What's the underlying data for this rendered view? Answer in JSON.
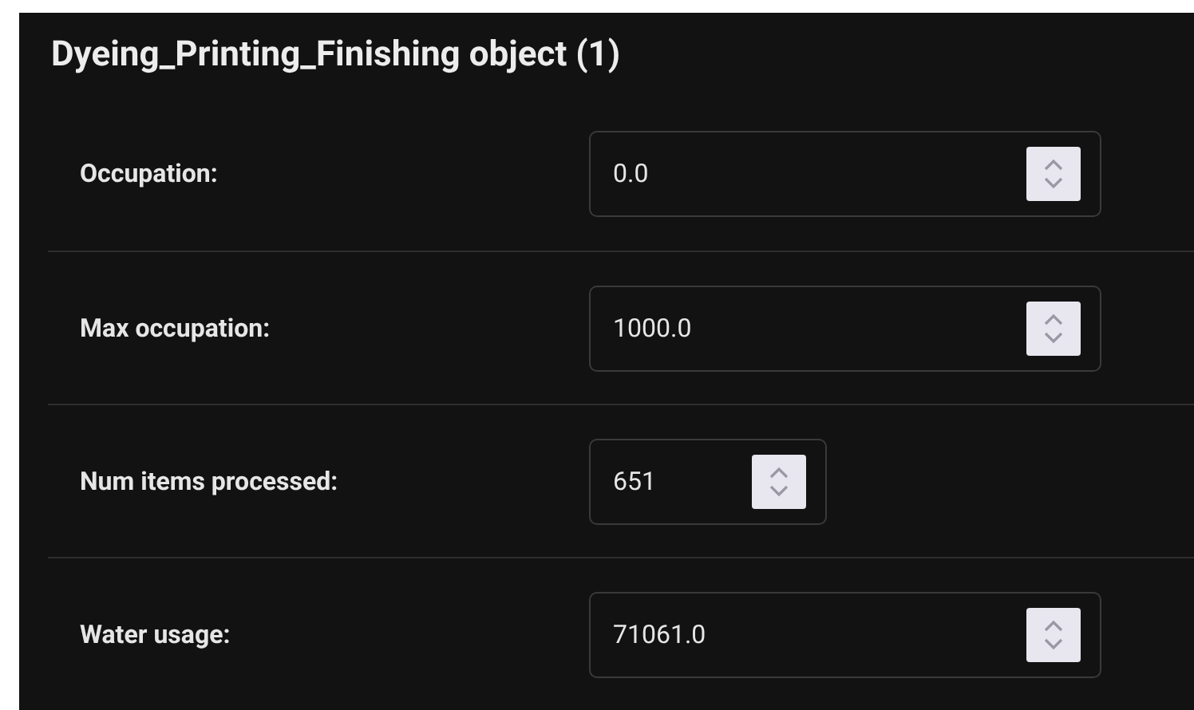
{
  "panel": {
    "title": "Dyeing_Printing_Finishing object (1)"
  },
  "fields": [
    {
      "label": "Occupation:",
      "value": "0.0",
      "kind": "decimal"
    },
    {
      "label": "Max occupation:",
      "value": "1000.0",
      "kind": "decimal"
    },
    {
      "label": "Num items processed:",
      "value": "651",
      "kind": "integer"
    },
    {
      "label": "Water usage:",
      "value": "71061.0",
      "kind": "decimal"
    }
  ]
}
